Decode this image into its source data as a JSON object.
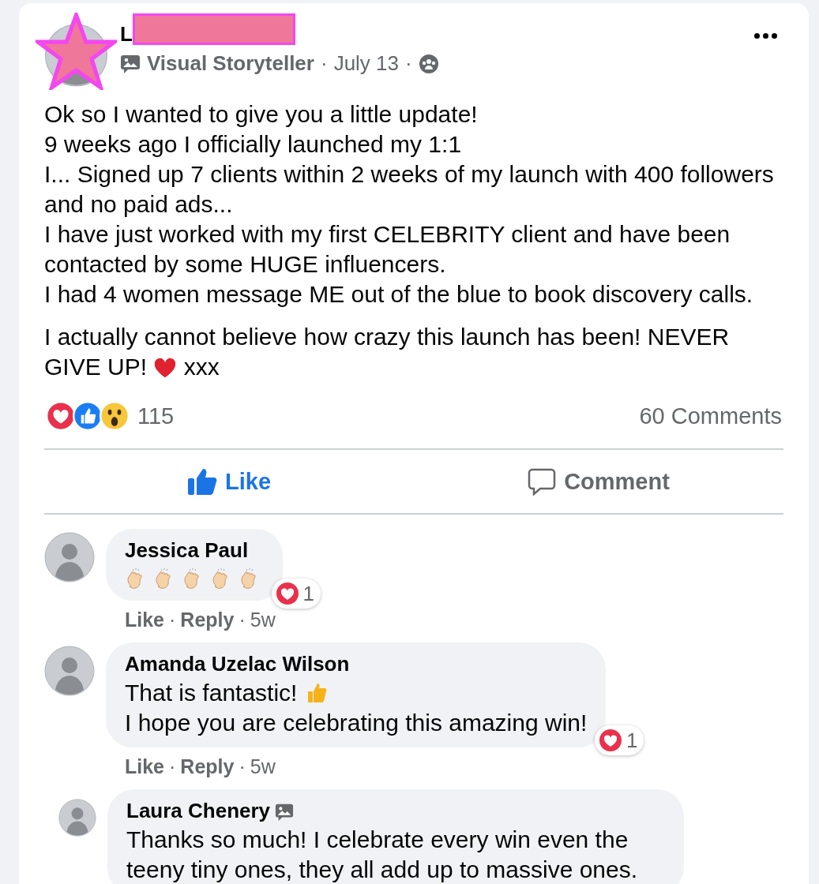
{
  "post": {
    "author": {
      "name": "L",
      "redacted": true
    },
    "meta": {
      "role": "Visual Storyteller",
      "date": "July 13",
      "separator": "·"
    },
    "lines": [
      "Ok so I wanted to give you a little update!",
      "9 weeks ago I officially launched my 1:1",
      "I... Signed up 7 clients within 2 weeks of my launch with 400 followers and no paid ads...",
      "I have just worked with my first CELEBRITY client and have been contacted by some HUGE influencers.",
      "I had 4 women message ME out of the blue to book discovery calls."
    ],
    "closing": [
      {
        "kind": "line",
        "text": "I actually cannot believe how crazy this launch has been! NEVER"
      },
      {
        "kind": "text",
        "text": "GIVE UP!"
      },
      {
        "kind": "heart"
      },
      {
        "kind": "text",
        "text": "xxx"
      }
    ],
    "reactions": {
      "kinds": [
        {
          "kind": "love"
        },
        {
          "kind": "like"
        },
        {
          "kind": "wow"
        }
      ],
      "count": "115",
      "comments": "60 Comments"
    },
    "actions": [
      {
        "label": "Like",
        "kind": "like",
        "selected": true
      },
      {
        "label": "Comment",
        "kind": "comment",
        "selected": false
      }
    ]
  },
  "comments": [
    {
      "author": "Jessica Paul",
      "badge": false,
      "body": [
        {
          "kind": "emojis",
          "emojis": [
            {
              "kind": "clap"
            },
            {
              "kind": "clap"
            },
            {
              "kind": "clap"
            },
            {
              "kind": "clap"
            },
            {
              "kind": "clap"
            }
          ]
        }
      ],
      "reaction": {
        "kind": "love",
        "count": "1"
      },
      "meta": {
        "like": "Like",
        "reply": "Reply",
        "time": "5w",
        "separator": "·"
      }
    },
    {
      "author": "Amanda Uzelac Wilson",
      "badge": false,
      "body": [
        {
          "kind": "text_thumbs",
          "text": "That is fantastic!"
        },
        {
          "kind": "text",
          "text": "I hope you are celebrating this amazing win!"
        }
      ],
      "reaction": {
        "kind": "love",
        "count": "1"
      },
      "meta": {
        "like": "Like",
        "reply": "Reply",
        "time": "5w",
        "separator": "·"
      },
      "children": [
        {
          "author": "Laura Chenery",
          "badge": true,
          "body": [
            {
              "kind": "text",
              "text": "Thanks so much! I celebrate every win even the teeny tiny ones, they all add up to massive ones."
            }
          ]
        }
      ]
    }
  ]
}
